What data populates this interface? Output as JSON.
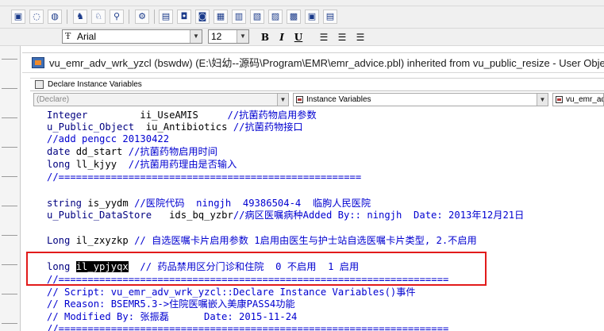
{
  "font_toolbar": {
    "font_name": "Arial",
    "font_size": "12",
    "bold_label": "B",
    "italic_label": "I",
    "underline_label": "U"
  },
  "window": {
    "title": "vu_emr_adv_wrk_yzcl (bswdw) (E:\\妇幼--源码\\Program\\EMR\\emr_advice.pbl) inherited from vu_public_resize - User Object"
  },
  "script_pane": {
    "title": "Declare Instance Variables",
    "scope_combo": "(Declare)",
    "kind_combo": "Instance Variables",
    "object_combo": "vu_emr_adv"
  },
  "code_lines": [
    {
      "kw": "Integer",
      "id": "         ii_UseAMIS     ",
      "cm": "//抗菌药物启用参数"
    },
    {
      "kw": "u_Public_Object",
      "id": "  iu_Antibiotics ",
      "cm": "//抗菌药物接口"
    },
    {
      "kw": "",
      "id": "",
      "cm": "//add pengcc 20130422"
    },
    {
      "kw": "date",
      "id": " dd_start ",
      "cm": "//抗菌药物启用时间"
    },
    {
      "kw": "long",
      "id": " ll_kjyy  ",
      "cm": "//抗菌用药理由是否输入"
    },
    {
      "kw": "",
      "id": "",
      "cm": "//===================================================="
    },
    {
      "kw": "string",
      "id": " is_yydm ",
      "cm": "//医院代码  ningjh  49386504-4  临朐人民医院"
    },
    {
      "kw": "u_Public_DataStore",
      "id": "   ids_bq_yzbr",
      "cm": "//病区医嘱病种Added By:: ningjh  Date: 2013年12月21日"
    },
    {
      "kw": "Long",
      "id": " il_zxyzkp ",
      "cm": "// 自选医嘱卡片启用参数 1启用由医生与护士站自选医嘱卡片类型, 2.不启用"
    },
    {
      "kw": "long",
      "id": "il_ypjyqx",
      "cm": "  // 药品禁用区分门诊和住院  0 不启用  1 启用"
    },
    {
      "kw": "",
      "id": "",
      "cm": "//==================================================================="
    },
    {
      "kw": "",
      "id": "",
      "cm": "// Script: vu_emr_adv_wrk_yzcl::Declare Instance Variables()事件"
    },
    {
      "kw": "",
      "id": "",
      "cm": "// Reason: BSEMR5.3->住院医嘱嵌入美康PASS4功能"
    },
    {
      "kw": "",
      "id": "",
      "cm": "// Modified By: 张振磊      Date: 2015-11-24"
    },
    {
      "kw": "",
      "id": "",
      "cm": "//==================================================================="
    }
  ]
}
